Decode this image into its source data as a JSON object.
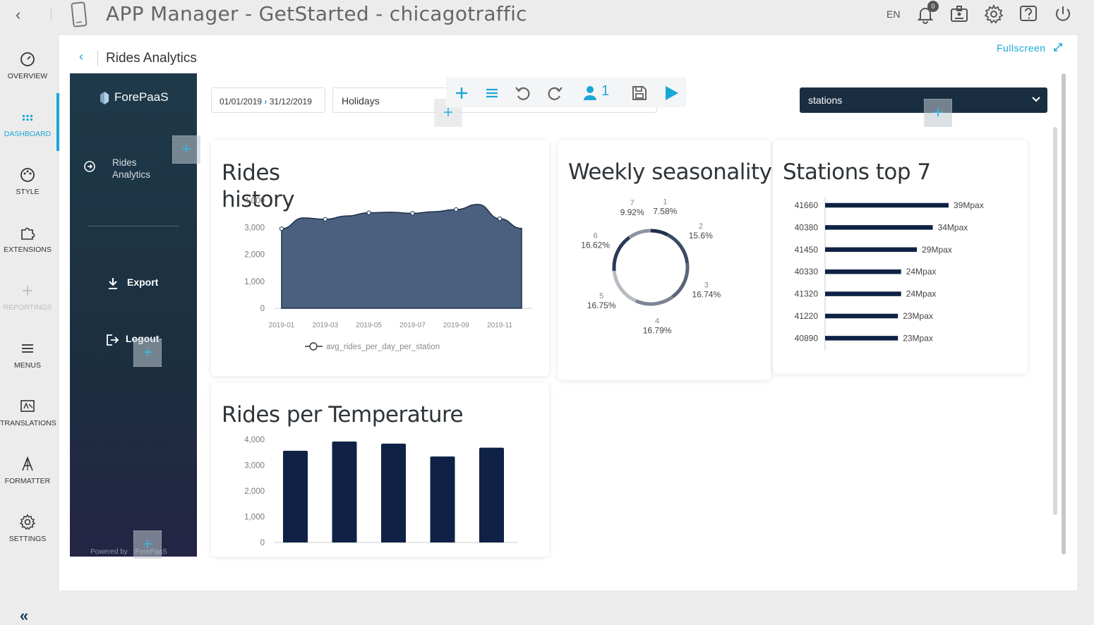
{
  "topbar": {
    "title": "APP Manager - GetStarted - chicagotraffic",
    "language": "EN",
    "notifications_count": "0"
  },
  "nav": {
    "items": [
      {
        "label": "OVERVIEW",
        "icon": "overview-gauge-icon"
      },
      {
        "label": "DASHBOARD",
        "icon": "dashboard-grid-icon"
      },
      {
        "label": "STYLE",
        "icon": "palette-icon"
      },
      {
        "label": "EXTENSIONS",
        "icon": "puzzle-icon"
      },
      {
        "label": "REPORTINGS",
        "icon": "plus-icon"
      },
      {
        "label": "MENUS",
        "icon": "hamburger-icon"
      },
      {
        "label": "TRANSLATIONS",
        "icon": "translate-icon"
      },
      {
        "label": "FORMATTER",
        "icon": "formatter-icon"
      },
      {
        "label": "SETTINGS",
        "icon": "gear-icon"
      }
    ],
    "collapse": "«"
  },
  "page": {
    "title": "Rides Analytics",
    "fullscreen_label": "Fullscreen"
  },
  "dash_sidebar": {
    "logo_text": "ForePaaS",
    "nav_item": "Rides Analytics",
    "export_label": "Export",
    "logout_label": "Logout",
    "powered_by": "Powered by",
    "powered_brand": "ForePaaS"
  },
  "filters": {
    "date_start": "01/01/2019",
    "date_end": "31/12/2019",
    "holidays": "Holidays",
    "stations": "stations",
    "toolbar_user_count": "1"
  },
  "colors": {
    "accent": "#1aa7d6",
    "navy": "#0f2245",
    "area": "#4b5f7e",
    "sidebar": "#1e3a4a"
  },
  "chart_data": [
    {
      "type": "area",
      "title": "Rides history",
      "ylabel": "",
      "ylim": [
        0,
        4000
      ],
      "yticks": [
        "4,000",
        "3,000",
        "2,000",
        "1,000",
        "0"
      ],
      "x_tick_labels": [
        "2019-01",
        "2019-03",
        "2019-05",
        "2019-07",
        "2019-09",
        "2019-11"
      ],
      "x": [
        "2019-01",
        "2019-02",
        "2019-03",
        "2019-04",
        "2019-05",
        "2019-06",
        "2019-07",
        "2019-08",
        "2019-09",
        "2019-10",
        "2019-11",
        "2019-12"
      ],
      "series": [
        {
          "name": "avg_rides_per_day_per_station",
          "values": [
            2950,
            3350,
            3300,
            3420,
            3540,
            3560,
            3520,
            3580,
            3660,
            3850,
            3320,
            2960
          ]
        }
      ],
      "markers": [
        "2019-01",
        "2019-03",
        "2019-05",
        "2019-07",
        "2019-09",
        "2019-11"
      ],
      "legend_position": "bottom"
    },
    {
      "type": "pie",
      "title": "Weekly seasonality",
      "categories": [
        "1",
        "2",
        "3",
        "4",
        "5",
        "6",
        "7"
      ],
      "values": [
        7.58,
        15.6,
        16.74,
        16.79,
        16.75,
        16.62,
        9.92
      ],
      "labels": [
        "7.58%",
        "15.6%",
        "16.74%",
        "16.79%",
        "16.75%",
        "16.62%",
        "9.92%"
      ]
    },
    {
      "type": "bar",
      "orientation": "horizontal",
      "title": "Stations top 7",
      "categories": [
        "41660",
        "40380",
        "41450",
        "40330",
        "41320",
        "41220",
        "40890"
      ],
      "values": [
        39,
        34,
        29,
        24,
        24,
        23,
        23
      ],
      "labels": [
        "39Mpax",
        "34Mpax",
        "29Mpax",
        "24Mpax",
        "24Mpax",
        "23Mpax",
        "23Mpax"
      ],
      "xlim": [
        0,
        39
      ]
    },
    {
      "type": "bar",
      "title": "Rides per Temperature",
      "categories": [
        "",
        "",
        "",
        "",
        ""
      ],
      "values": [
        3560,
        3920,
        3840,
        3340,
        3680
      ],
      "ylim": [
        0,
        4000
      ],
      "yticks": [
        "4,000",
        "3,000",
        "2,000",
        "1,000",
        "0"
      ]
    }
  ]
}
